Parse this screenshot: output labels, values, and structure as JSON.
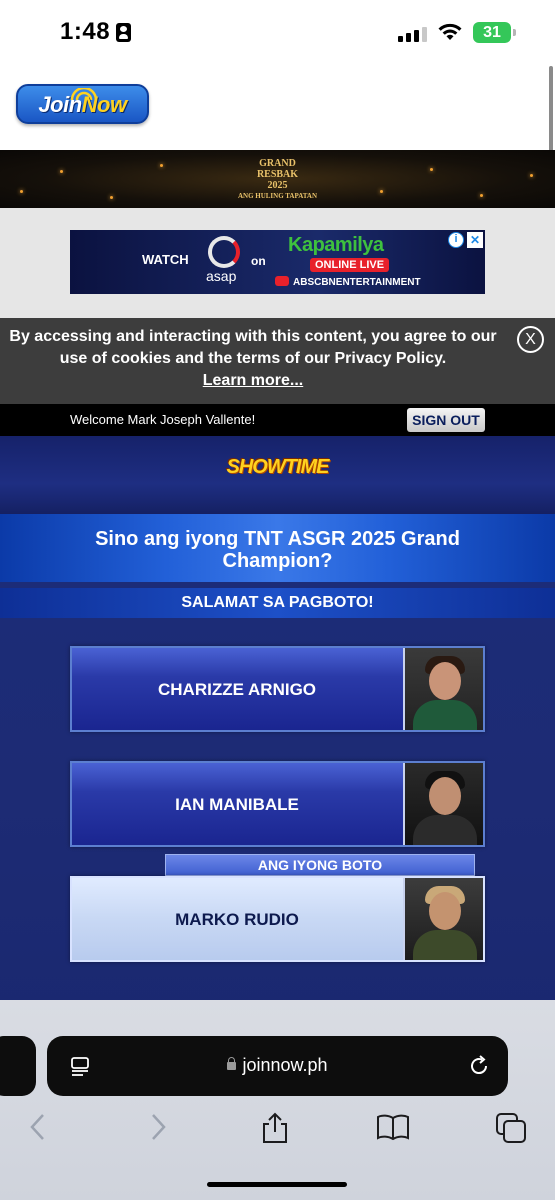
{
  "status_bar": {
    "time": "1:48",
    "battery": "31"
  },
  "header": {
    "logo_part1": "Join",
    "logo_part2": "Now"
  },
  "banner": {
    "line1": "GRAND",
    "line2": "RESBAK",
    "line3": "2025",
    "line4": "ANG HULING TAPATAN"
  },
  "ad": {
    "watch": "WATCH",
    "asap": "asap",
    "on": "on",
    "kapamilya": "Kapamilya",
    "online_live": "ONLINE LIVE",
    "channel": "ABSCBNENTERTAINMENT",
    "info_glyph": "i",
    "close_glyph": "✕"
  },
  "cookie": {
    "text": "By accessing and interacting with this content, you agree to our use of cookies and the terms of our Privacy Policy.",
    "link": "Learn more...",
    "close": "X"
  },
  "welcome": {
    "text": "Welcome Mark Joseph Vallente!",
    "signout": "SIGN OUT"
  },
  "vote": {
    "show_logo": "SHOWTIME",
    "question": "Sino ang iyong TNT ASGR 2025 Grand Champion?",
    "thanks": "SALAMAT SA PAGBOTO!",
    "your_vote_label": "ANG IYONG BOTO",
    "candidates": [
      {
        "name": "CHARIZZE ARNIGO",
        "selected": false
      },
      {
        "name": "IAN MANIBALE",
        "selected": false
      },
      {
        "name": "MARKO RUDIO",
        "selected": true
      }
    ]
  },
  "browser": {
    "url": "joinnow.ph"
  },
  "colors": {
    "accent_blue": "#1d50c8",
    "battery_green": "#34c759",
    "cookie_bg": "#3d3d3d"
  }
}
